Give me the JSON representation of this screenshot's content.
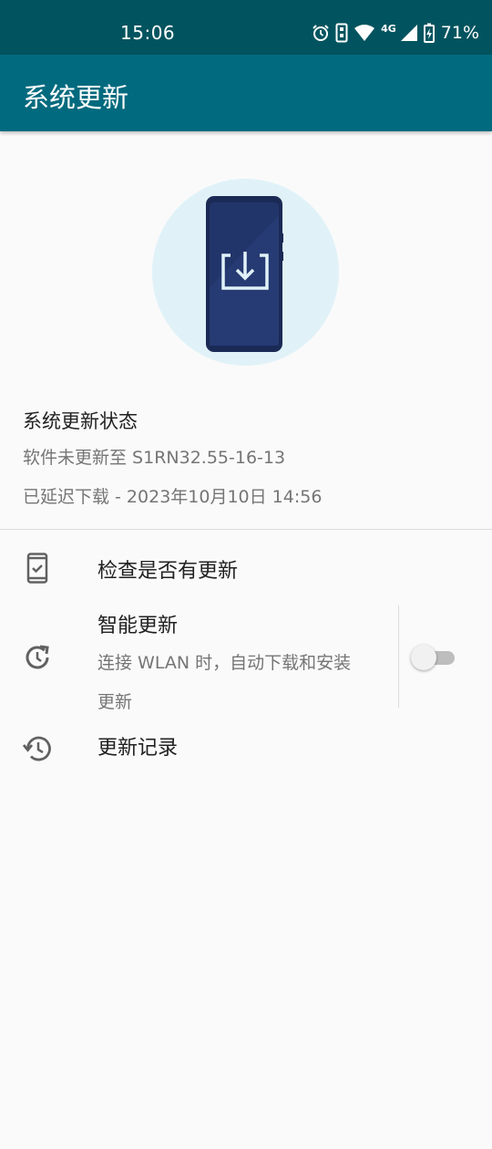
{
  "status_bar": {
    "time": "15:06",
    "network": "4G",
    "battery": "71%",
    "icons": [
      "alarm-icon",
      "vibrate-icon",
      "wifi-icon",
      "signal-icon",
      "battery-charging-icon"
    ]
  },
  "app_bar": {
    "title": "系统更新"
  },
  "hero": {
    "icon": "phone-download-icon",
    "circle_color": "#e0f2f8",
    "phone_color": "#1f3163"
  },
  "update_status": {
    "title": "系统更新状态",
    "version_line": "软件未更新至 S1RN32.55-16-13",
    "deferred_line": "已延迟下载 - 2023年10月10日 14:56"
  },
  "menu": {
    "check": {
      "label": "检查是否有更新",
      "icon": "phone-check-icon"
    },
    "smart": {
      "label": "智能更新",
      "desc_line1": "连接 WLAN 时，自动下载和安装",
      "desc_line2": "更新",
      "icon": "clock-refresh-icon",
      "toggle_on": false
    },
    "history": {
      "label": "更新记录",
      "icon": "history-icon"
    }
  },
  "colors": {
    "status_bar": "#01545f",
    "app_bar": "#026a7e",
    "background": "#fafafa"
  }
}
